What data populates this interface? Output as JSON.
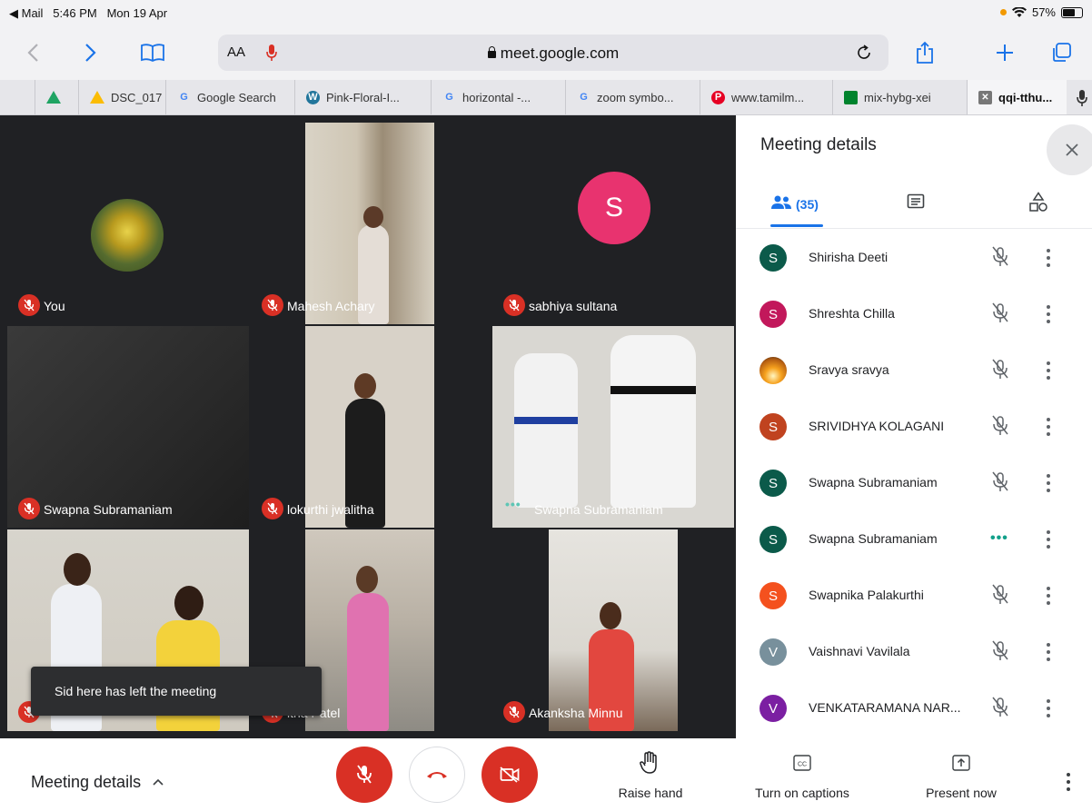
{
  "status_bar": {
    "back_app": "◀ Mail",
    "time": "5:46 PM",
    "date": "Mon 19 Apr",
    "battery": "57%"
  },
  "browser": {
    "text_size": "AA",
    "url": "meet.google.com"
  },
  "tabs": [
    {
      "label": "DSC_017",
      "icon": "drive-icon"
    },
    {
      "label": "Google Search",
      "icon": "google-icon"
    },
    {
      "label": "Pink-Floral-I...",
      "icon": "wordpress-icon"
    },
    {
      "label": "horizontal -...",
      "icon": "google-icon"
    },
    {
      "label": "zoom symbo...",
      "icon": "google-icon"
    },
    {
      "label": "www.tamilm...",
      "icon": "pinterest-icon"
    },
    {
      "label": "mix-hybg-xei",
      "icon": "meet-icon"
    },
    {
      "label": "qqi-tthu...",
      "icon": "close-tab-icon"
    }
  ],
  "tiles": [
    {
      "name": "You"
    },
    {
      "name": "Mahesh Achary"
    },
    {
      "name": "sabhiya sultana",
      "avatar_letter": "S"
    },
    {
      "name": "Swapna Subramaniam"
    },
    {
      "name": "lokurthi jwalitha"
    },
    {
      "name": "Swapna Subramaniam"
    },
    {
      "name": ""
    },
    {
      "name": "itha Patel"
    },
    {
      "name": "Akanksha Minnu"
    }
  ],
  "toast": "Sid here has left the meeting",
  "panel": {
    "title": "Meeting details",
    "people_count": "(35)",
    "participants": [
      {
        "name": "Shirisha Deeti",
        "letter": "S",
        "color": "#0b5a4a",
        "status": "muted"
      },
      {
        "name": "Shreshta Chilla",
        "letter": "S",
        "color": "#c2185b",
        "status": "muted"
      },
      {
        "name": "Sravya sravya",
        "letter": "",
        "color": "#f2a33a",
        "status": "muted"
      },
      {
        "name": "SRIVIDHYA KOLAGANI",
        "letter": "S",
        "color": "#c0431f",
        "status": "muted"
      },
      {
        "name": "Swapna Subramaniam",
        "letter": "S",
        "color": "#0b5a4a",
        "status": "muted"
      },
      {
        "name": "Swapna Subramaniam",
        "letter": "S",
        "color": "#0b5a4a",
        "status": "speaking"
      },
      {
        "name": "Swapnika Palakurthi",
        "letter": "S",
        "color": "#f4511e",
        "status": "muted"
      },
      {
        "name": "Vaishnavi Vavilala",
        "letter": "V",
        "color": "#78909c",
        "status": "muted"
      },
      {
        "name": "VENKATARAMANA NAR...",
        "letter": "V",
        "color": "#7b1fa2",
        "status": "muted"
      }
    ]
  },
  "bottom_bar": {
    "meeting_details": "Meeting details",
    "raise_hand": "Raise hand",
    "captions": "Turn on captions",
    "present": "Present now"
  },
  "colors": {
    "danger": "#d93025",
    "accent": "#1a73e8",
    "meet_bg": "#202124"
  }
}
